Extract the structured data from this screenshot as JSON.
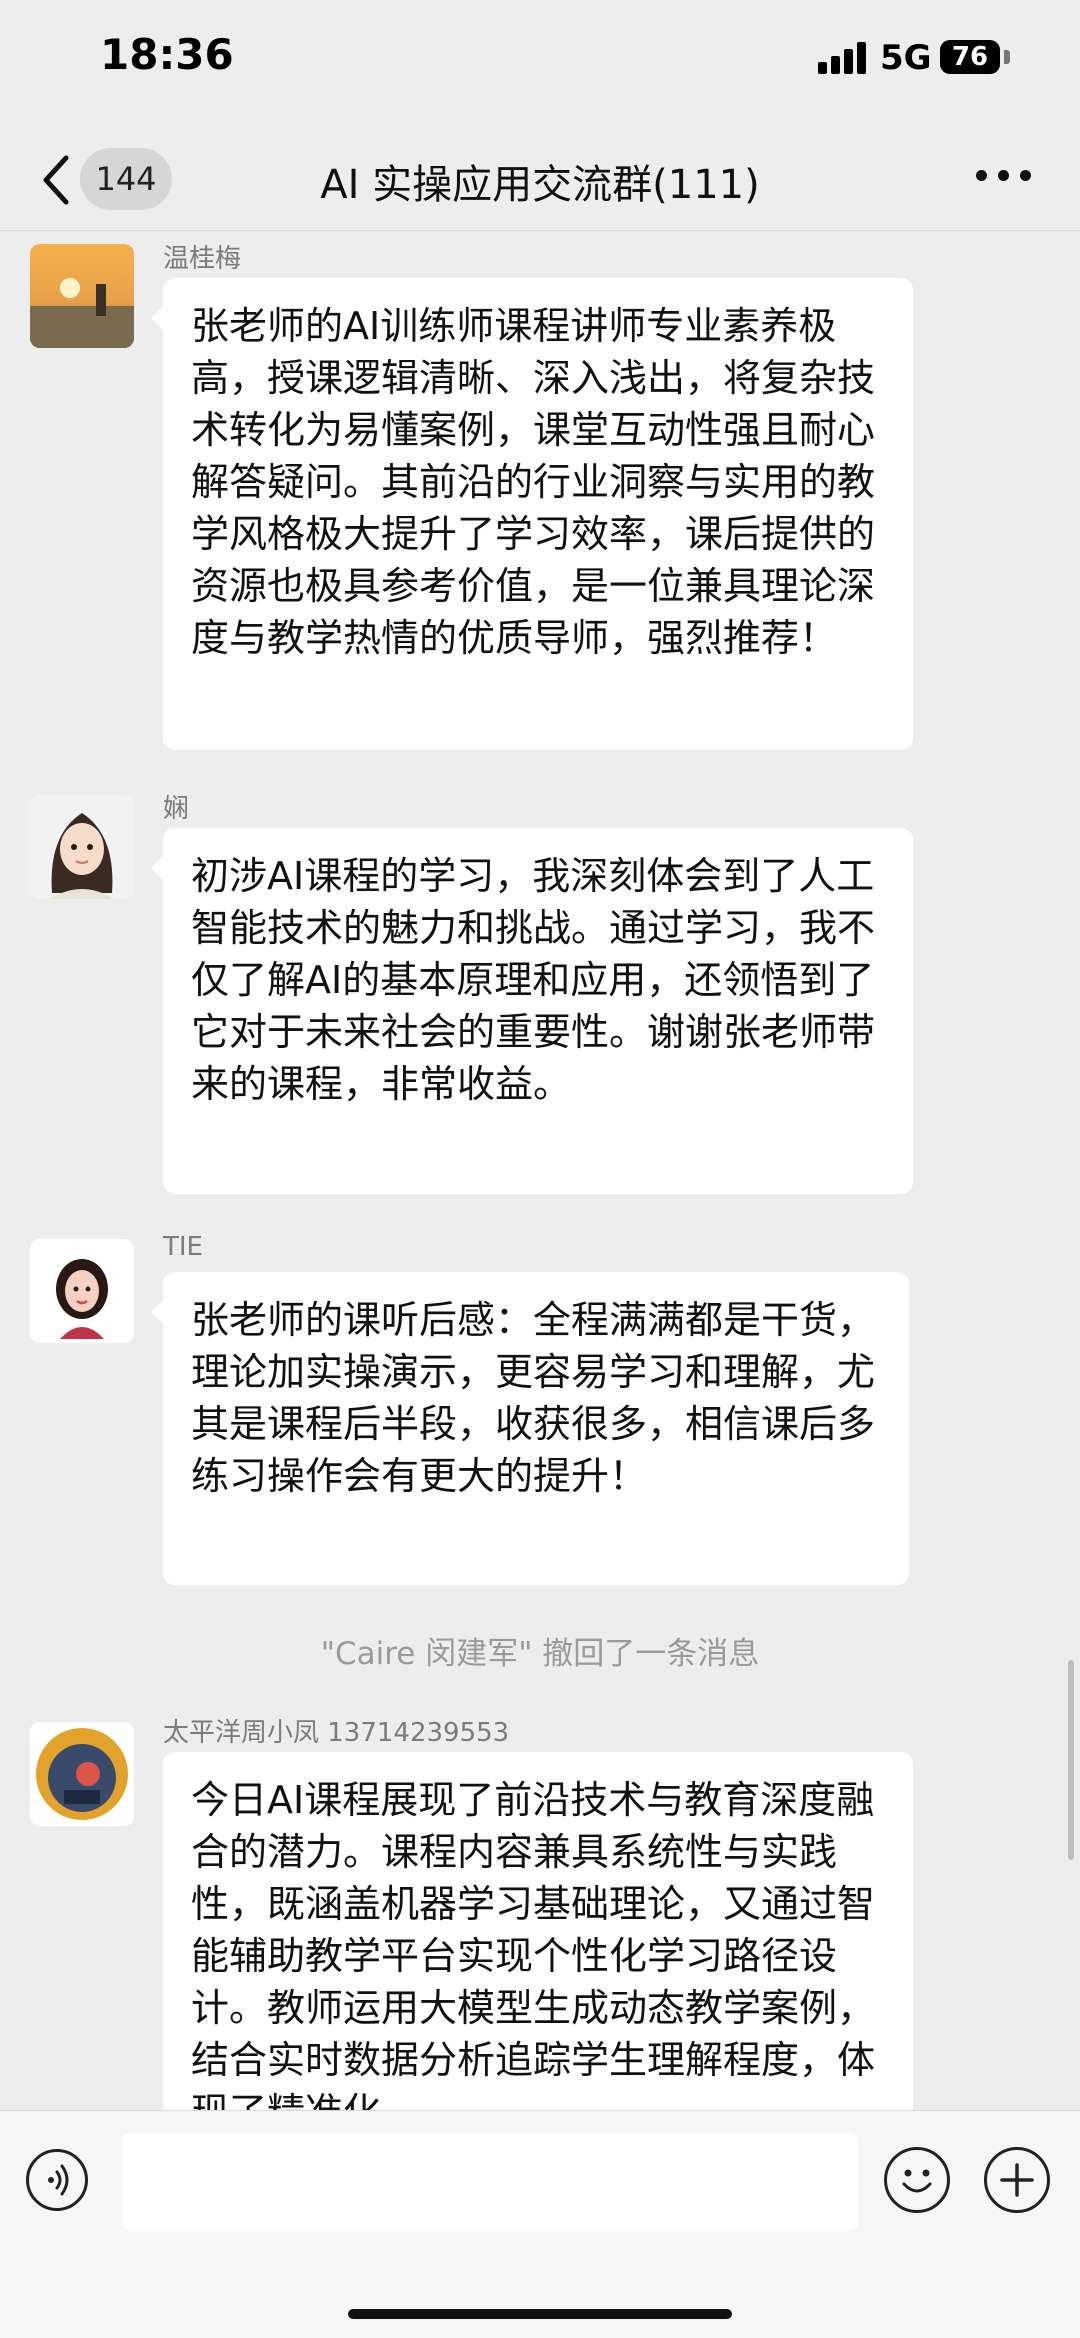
{
  "status_bar": {
    "time": "18:36",
    "network": "5G",
    "battery": "76"
  },
  "header": {
    "unread_count": "144",
    "title": "AI 实操应用交流群(111)"
  },
  "messages": [
    {
      "sender": "温桂梅",
      "text": "张老师的AI训练师课程讲师专业素养极高，授课逻辑清晰、深入浅出，将复杂技术转化为易懂案例，课堂互动性强且耐心解答疑问。其前沿的行业洞察与实用的教学风格极大提升了学习效率，课后提供的资源也极具参考价值，是一位兼具理论深度与教学热情的优质导师，强烈推荐！"
    },
    {
      "sender": "娴",
      "text": "初涉AI课程的学习，我深刻体会到了人工智能技术的魅力和挑战。通过学习，我不仅了解AI的基本原理和应用，还领悟到了它对于未来社会的重要性。谢谢张老师带来的课程，非常收益。"
    },
    {
      "sender": "TIE",
      "text": "张老师的课听后感：全程满满都是干货，理论加实操演示，更容易学习和理解，尤其是课程后半段，收获很多，相信课后多练习操作会有更大的提升！"
    },
    {
      "sender": "太平洋周小凤 13714239553",
      "text": "今日AI课程展现了前沿技术与教育深度融合的潜力。课程内容兼具系统性与实践性，既涵盖机器学习基础理论，又通过智能辅助教学平台实现个性化学习路径设计。教师运用大模型生成动态教学案例，结合实时数据分析追踪学生理解程度，体现了精准化"
    }
  ],
  "system_notice": "\"Caire 闵建军\" 撤回了一条消息",
  "colors": {
    "background": "#ededed",
    "bubble": "#ffffff",
    "meta_text": "#7b7b7b"
  }
}
